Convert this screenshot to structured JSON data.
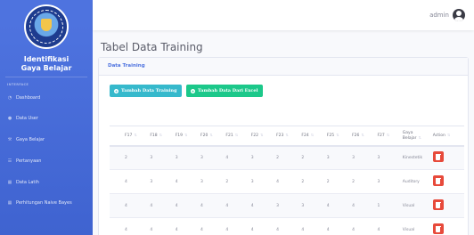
{
  "sidebar": {
    "brand_line1": "Identifikasi",
    "brand_line2": "Gaya Belajar",
    "heading": "INTERFACE",
    "items": [
      {
        "label": "Dashboard",
        "icon": "gauge-icon"
      },
      {
        "label": "Data User",
        "icon": "users-icon"
      },
      {
        "label": "Gaya Belajar",
        "icon": "wrench-icon"
      },
      {
        "label": "Pertanyaan",
        "icon": "list-icon"
      },
      {
        "label": "Data Latih",
        "icon": "table-icon"
      },
      {
        "label": "Perhitungan Naive Bayes",
        "icon": "table-icon"
      }
    ]
  },
  "topbar": {
    "username": "admin"
  },
  "page": {
    "title": "Tabel Data Training"
  },
  "card": {
    "header": "Data Training",
    "btn_add": "Tambah Data Training",
    "btn_import": "Tambah Data Dari Excel"
  },
  "table": {
    "headers": [
      "",
      "F17",
      "F18",
      "F19",
      "F20",
      "F21",
      "F22",
      "F23",
      "F24",
      "F25",
      "F26",
      "F27",
      "Gaya Belajar",
      "Action"
    ],
    "rows": [
      [
        "2",
        "3",
        "3",
        "3",
        "4",
        "3",
        "2",
        "2",
        "3",
        "3",
        "3",
        "Kinestetik"
      ],
      [
        "4",
        "3",
        "4",
        "3",
        "2",
        "3",
        "4",
        "2",
        "2",
        "2",
        "3",
        "Auditory"
      ],
      [
        "4",
        "4",
        "4",
        "4",
        "4",
        "4",
        "3",
        "3",
        "4",
        "4",
        "1",
        "Visual"
      ],
      [
        "4",
        "4",
        "4",
        "4",
        "4",
        "4",
        "4",
        "4",
        "4",
        "4",
        "4",
        "Visual"
      ]
    ]
  },
  "colors": {
    "sidebar": "#4e73df",
    "info": "#36b9cc",
    "success": "#1cc88a",
    "danger": "#e74a3b"
  }
}
